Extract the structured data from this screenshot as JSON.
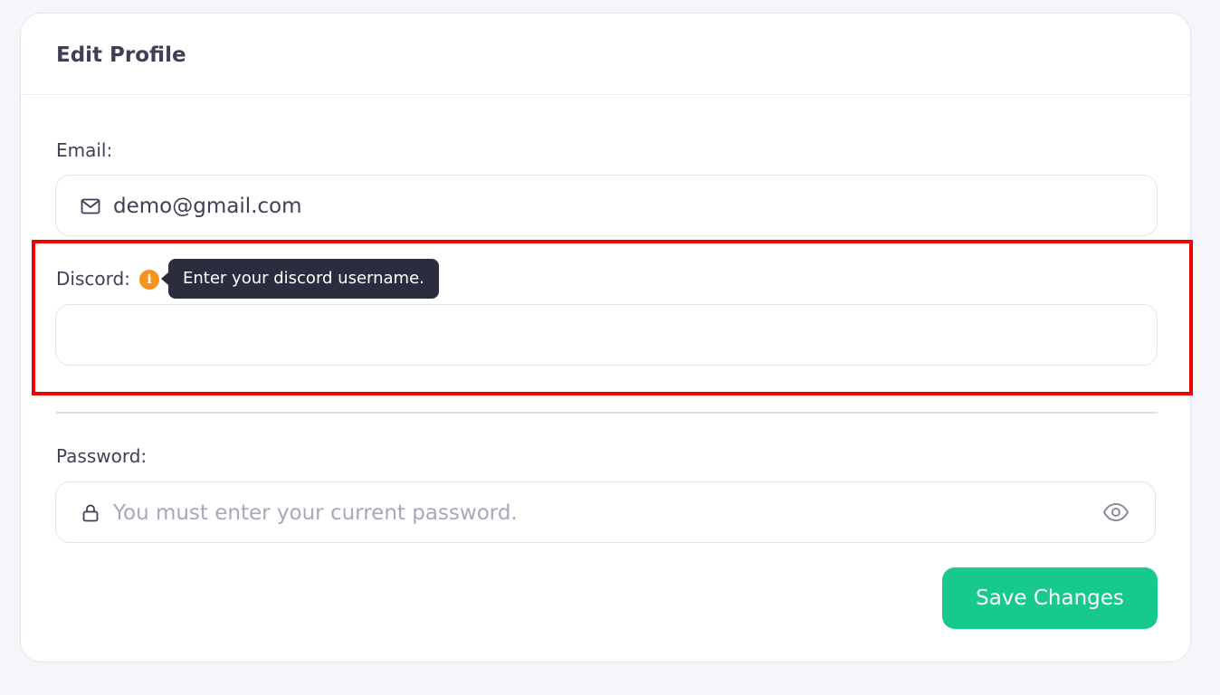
{
  "card": {
    "title": "Edit Profile"
  },
  "email": {
    "label": "Email:",
    "value": "demo@gmail.com",
    "icon": "mail-icon"
  },
  "discord": {
    "label": "Discord:",
    "info_icon": "info-icon",
    "tooltip": "Enter your discord username.",
    "value": "",
    "placeholder": ""
  },
  "password": {
    "label": "Password:",
    "placeholder": "You must enter your current password.",
    "lock_icon": "lock-icon",
    "toggle_icon": "eye-icon"
  },
  "actions": {
    "save_label": "Save Changes"
  },
  "colors": {
    "accent": "#17c88f",
    "info": "#f7931e",
    "highlight": "#ee0000",
    "tooltip_bg": "#2b2d3f"
  }
}
